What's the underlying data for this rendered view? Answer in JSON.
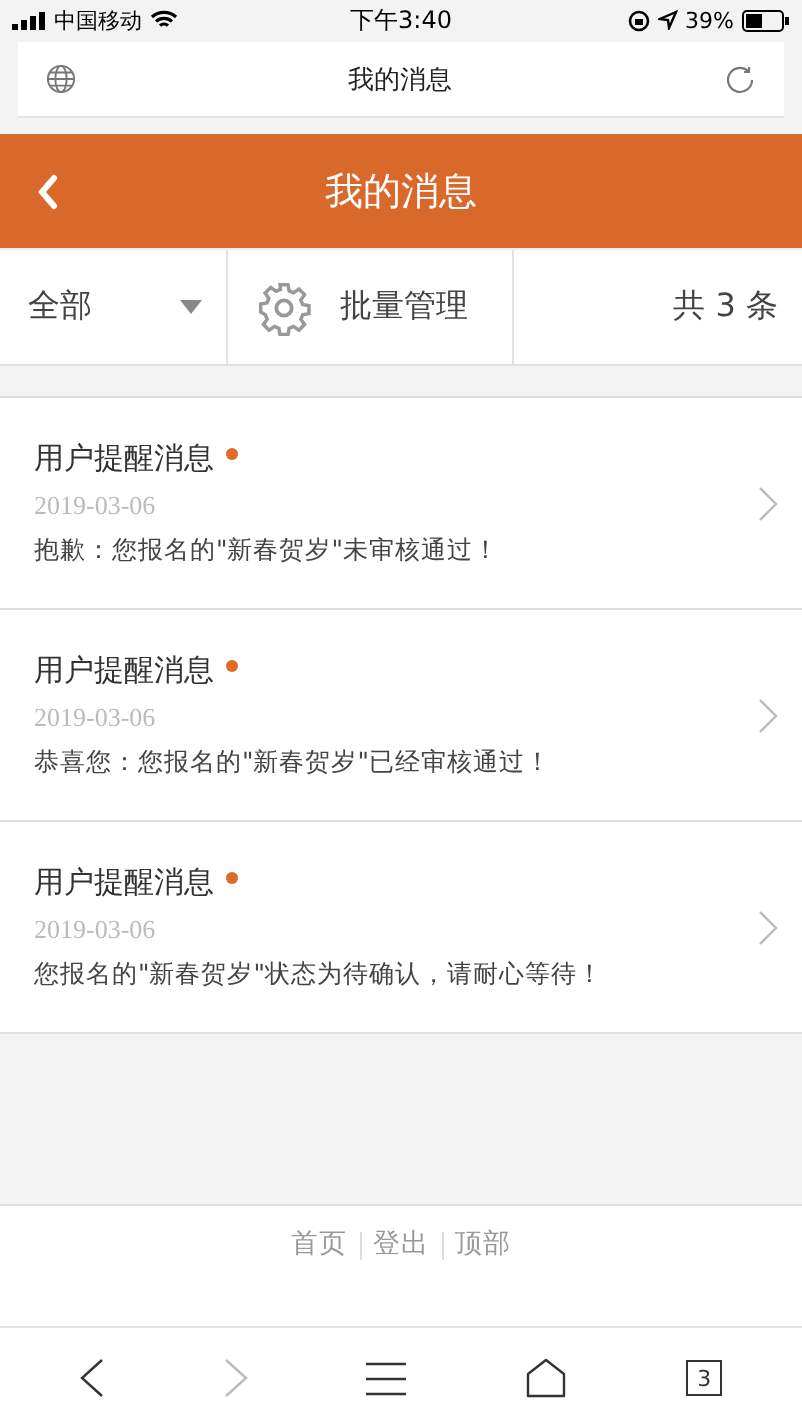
{
  "status_bar": {
    "carrier": "中国移动",
    "time": "下午3:40",
    "battery": "39%"
  },
  "address_bar": {
    "title": "我的消息"
  },
  "header": {
    "title": "我的消息"
  },
  "filter_bar": {
    "filter": "全部",
    "batch_button": "批量管理",
    "count": "共 3 条"
  },
  "messages": [
    {
      "title": "用户提醒消息",
      "unread": true,
      "date": "2019-03-06",
      "text": "抱歉：您报名的\"新春贺岁\"未审核通过！"
    },
    {
      "title": "用户提醒消息",
      "unread": true,
      "date": "2019-03-06",
      "text": "恭喜您：您报名的\"新春贺岁\"已经审核通过！"
    },
    {
      "title": "用户提醒消息",
      "unread": true,
      "date": "2019-03-06",
      "text": "您报名的\"新春贺岁\"状态为待确认，请耐心等待！"
    }
  ],
  "footer_links": [
    "首页",
    "登出",
    "顶部"
  ],
  "browser_toolbar": {
    "forward_disabled": true,
    "tab_count": "3"
  }
}
